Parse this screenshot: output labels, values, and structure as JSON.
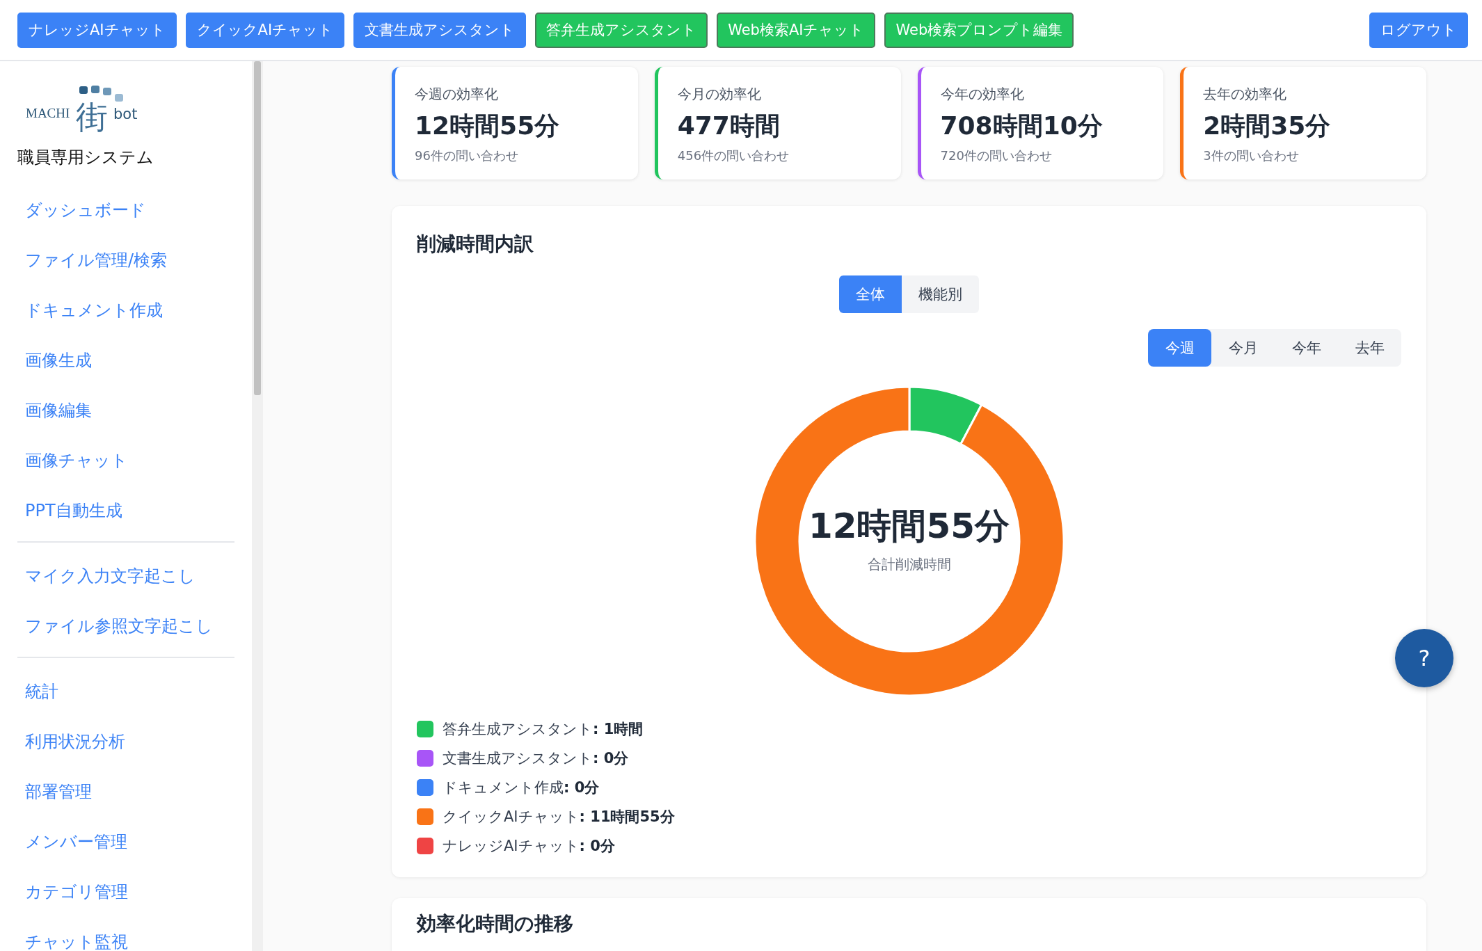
{
  "top_nav": {
    "buttons": [
      {
        "label": "ナレッジAIチャット",
        "kind": "primary"
      },
      {
        "label": "クイックAIチャット",
        "kind": "primary"
      },
      {
        "label": "文書生成アシスタント",
        "kind": "primary"
      },
      {
        "label": "答弁生成アシスタント",
        "kind": "success"
      },
      {
        "label": "Web検索AIチャット",
        "kind": "success"
      },
      {
        "label": "Web検索プロンプト編集",
        "kind": "success"
      }
    ],
    "logout": "ログアウト"
  },
  "sidebar": {
    "logo": {
      "left": "MACHI",
      "mark": "街",
      "right": "bot"
    },
    "subtitle": "職員専用システム",
    "groups": [
      {
        "items": [
          "ダッシュボード",
          "ファイル管理/検索",
          "ドキュメント作成",
          "画像生成",
          "画像編集",
          "画像チャット",
          "PPT自動生成"
        ]
      },
      {
        "items": [
          "マイク入力文字起こし",
          "ファイル参照文字起こし"
        ]
      },
      {
        "items": [
          "統計",
          "利用状況分析",
          "部署管理",
          "メンバー管理",
          "カテゴリ管理",
          "チャット監視"
        ]
      }
    ]
  },
  "stat_cards": [
    {
      "title": "今週の効率化",
      "value": "12時間55分",
      "note": "96件の問い合わせ",
      "color": "#3b82f6"
    },
    {
      "title": "今月の効率化",
      "value": "477時間",
      "note": "456件の問い合わせ",
      "color": "#22c55e"
    },
    {
      "title": "今年の効率化",
      "value": "708時間10分",
      "note": "720件の問い合わせ",
      "color": "#a855f7"
    },
    {
      "title": "去年の効率化",
      "value": "2時間35分",
      "note": "3件の問い合わせ",
      "color": "#f97316"
    }
  ],
  "breakdown": {
    "title": "削減時間内訳",
    "view_toggle": [
      {
        "label": "全体",
        "selected": true
      },
      {
        "label": "機能別",
        "selected": false
      }
    ],
    "period_tabs": [
      {
        "label": "今週",
        "selected": true
      },
      {
        "label": "今月",
        "selected": false
      },
      {
        "label": "今年",
        "selected": false
      },
      {
        "label": "去年",
        "selected": false
      }
    ],
    "center_value": "12時間55分",
    "center_label": "合計削減時間",
    "chart_data": {
      "type": "donut",
      "categories": [
        "答弁生成アシスタント",
        "文書生成アシスタント",
        "ドキュメント作成",
        "クイックAIチャット",
        "ナレッジAIチャット"
      ],
      "values": [
        7.74,
        0,
        0,
        92.26,
        0
      ]
    },
    "legend": [
      {
        "reading": ": 1時間",
        "color": "#22c55e"
      },
      {
        "reading": ": 0分",
        "color": "#a855f7"
      },
      {
        "reading": ": 0分",
        "color": "#3b82f6"
      },
      {
        "reading": ": 11時間55分",
        "color": "#f97316"
      },
      {
        "reading": ": 0分",
        "color": "#ef4444"
      }
    ]
  },
  "trend": {
    "title": "効率化時間の推移"
  },
  "help_button": {
    "label": "?"
  }
}
